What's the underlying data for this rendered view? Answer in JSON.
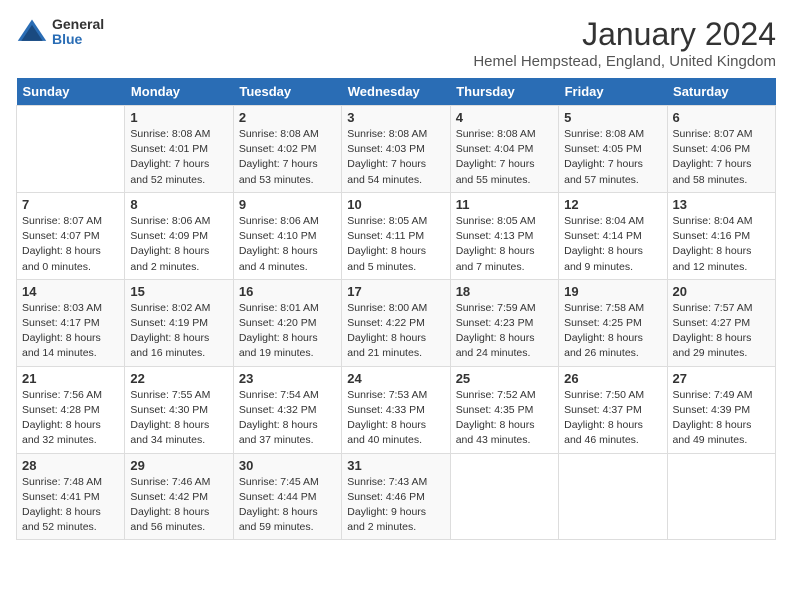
{
  "logo": {
    "general": "General",
    "blue": "Blue"
  },
  "title": "January 2024",
  "location": "Hemel Hempstead, England, United Kingdom",
  "days_of_week": [
    "Sunday",
    "Monday",
    "Tuesday",
    "Wednesday",
    "Thursday",
    "Friday",
    "Saturday"
  ],
  "weeks": [
    [
      {
        "num": "",
        "detail": ""
      },
      {
        "num": "1",
        "detail": "Sunrise: 8:08 AM\nSunset: 4:01 PM\nDaylight: 7 hours\nand 52 minutes."
      },
      {
        "num": "2",
        "detail": "Sunrise: 8:08 AM\nSunset: 4:02 PM\nDaylight: 7 hours\nand 53 minutes."
      },
      {
        "num": "3",
        "detail": "Sunrise: 8:08 AM\nSunset: 4:03 PM\nDaylight: 7 hours\nand 54 minutes."
      },
      {
        "num": "4",
        "detail": "Sunrise: 8:08 AM\nSunset: 4:04 PM\nDaylight: 7 hours\nand 55 minutes."
      },
      {
        "num": "5",
        "detail": "Sunrise: 8:08 AM\nSunset: 4:05 PM\nDaylight: 7 hours\nand 57 minutes."
      },
      {
        "num": "6",
        "detail": "Sunrise: 8:07 AM\nSunset: 4:06 PM\nDaylight: 7 hours\nand 58 minutes."
      }
    ],
    [
      {
        "num": "7",
        "detail": "Sunrise: 8:07 AM\nSunset: 4:07 PM\nDaylight: 8 hours\nand 0 minutes."
      },
      {
        "num": "8",
        "detail": "Sunrise: 8:06 AM\nSunset: 4:09 PM\nDaylight: 8 hours\nand 2 minutes."
      },
      {
        "num": "9",
        "detail": "Sunrise: 8:06 AM\nSunset: 4:10 PM\nDaylight: 8 hours\nand 4 minutes."
      },
      {
        "num": "10",
        "detail": "Sunrise: 8:05 AM\nSunset: 4:11 PM\nDaylight: 8 hours\nand 5 minutes."
      },
      {
        "num": "11",
        "detail": "Sunrise: 8:05 AM\nSunset: 4:13 PM\nDaylight: 8 hours\nand 7 minutes."
      },
      {
        "num": "12",
        "detail": "Sunrise: 8:04 AM\nSunset: 4:14 PM\nDaylight: 8 hours\nand 9 minutes."
      },
      {
        "num": "13",
        "detail": "Sunrise: 8:04 AM\nSunset: 4:16 PM\nDaylight: 8 hours\nand 12 minutes."
      }
    ],
    [
      {
        "num": "14",
        "detail": "Sunrise: 8:03 AM\nSunset: 4:17 PM\nDaylight: 8 hours\nand 14 minutes."
      },
      {
        "num": "15",
        "detail": "Sunrise: 8:02 AM\nSunset: 4:19 PM\nDaylight: 8 hours\nand 16 minutes."
      },
      {
        "num": "16",
        "detail": "Sunrise: 8:01 AM\nSunset: 4:20 PM\nDaylight: 8 hours\nand 19 minutes."
      },
      {
        "num": "17",
        "detail": "Sunrise: 8:00 AM\nSunset: 4:22 PM\nDaylight: 8 hours\nand 21 minutes."
      },
      {
        "num": "18",
        "detail": "Sunrise: 7:59 AM\nSunset: 4:23 PM\nDaylight: 8 hours\nand 24 minutes."
      },
      {
        "num": "19",
        "detail": "Sunrise: 7:58 AM\nSunset: 4:25 PM\nDaylight: 8 hours\nand 26 minutes."
      },
      {
        "num": "20",
        "detail": "Sunrise: 7:57 AM\nSunset: 4:27 PM\nDaylight: 8 hours\nand 29 minutes."
      }
    ],
    [
      {
        "num": "21",
        "detail": "Sunrise: 7:56 AM\nSunset: 4:28 PM\nDaylight: 8 hours\nand 32 minutes."
      },
      {
        "num": "22",
        "detail": "Sunrise: 7:55 AM\nSunset: 4:30 PM\nDaylight: 8 hours\nand 34 minutes."
      },
      {
        "num": "23",
        "detail": "Sunrise: 7:54 AM\nSunset: 4:32 PM\nDaylight: 8 hours\nand 37 minutes."
      },
      {
        "num": "24",
        "detail": "Sunrise: 7:53 AM\nSunset: 4:33 PM\nDaylight: 8 hours\nand 40 minutes."
      },
      {
        "num": "25",
        "detail": "Sunrise: 7:52 AM\nSunset: 4:35 PM\nDaylight: 8 hours\nand 43 minutes."
      },
      {
        "num": "26",
        "detail": "Sunrise: 7:50 AM\nSunset: 4:37 PM\nDaylight: 8 hours\nand 46 minutes."
      },
      {
        "num": "27",
        "detail": "Sunrise: 7:49 AM\nSunset: 4:39 PM\nDaylight: 8 hours\nand 49 minutes."
      }
    ],
    [
      {
        "num": "28",
        "detail": "Sunrise: 7:48 AM\nSunset: 4:41 PM\nDaylight: 8 hours\nand 52 minutes."
      },
      {
        "num": "29",
        "detail": "Sunrise: 7:46 AM\nSunset: 4:42 PM\nDaylight: 8 hours\nand 56 minutes."
      },
      {
        "num": "30",
        "detail": "Sunrise: 7:45 AM\nSunset: 4:44 PM\nDaylight: 8 hours\nand 59 minutes."
      },
      {
        "num": "31",
        "detail": "Sunrise: 7:43 AM\nSunset: 4:46 PM\nDaylight: 9 hours\nand 2 minutes."
      },
      {
        "num": "",
        "detail": ""
      },
      {
        "num": "",
        "detail": ""
      },
      {
        "num": "",
        "detail": ""
      }
    ]
  ]
}
